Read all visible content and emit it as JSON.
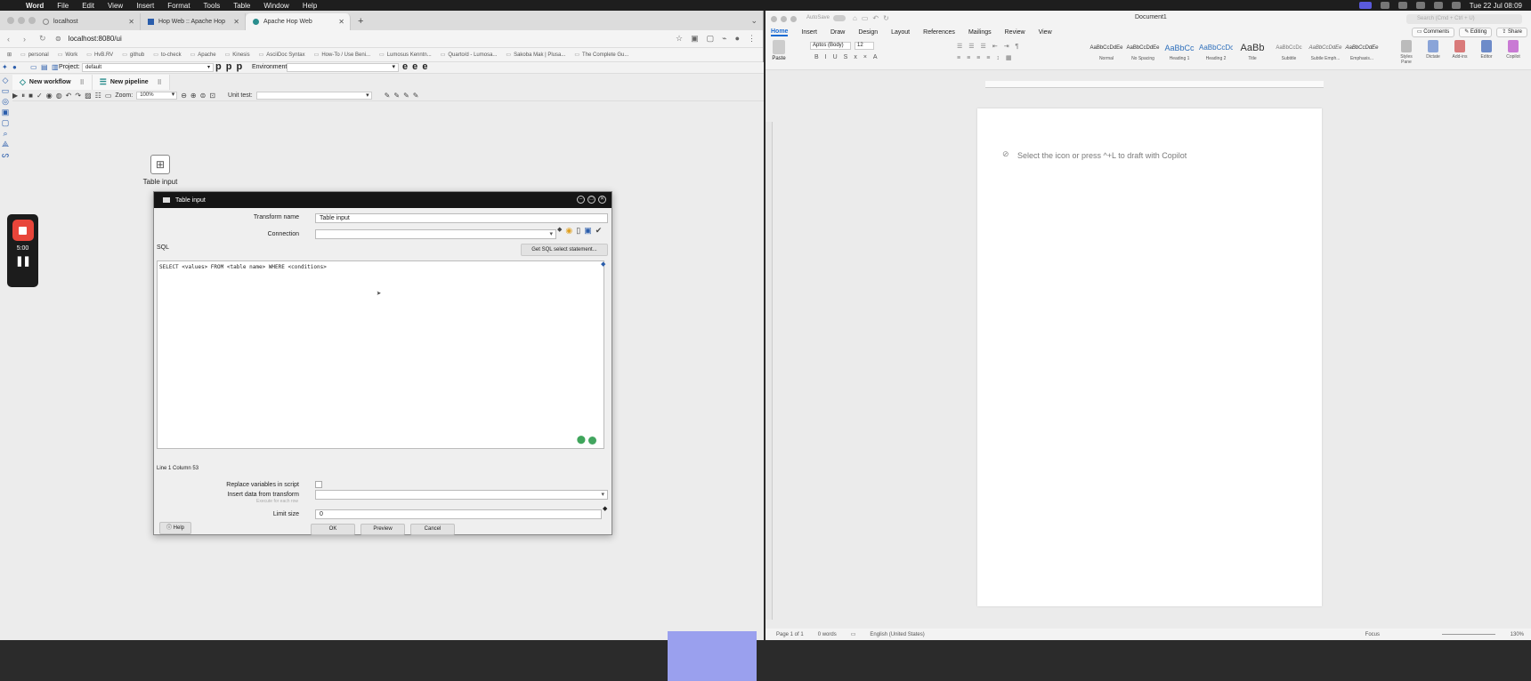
{
  "mac": {
    "app": "Word",
    "menus": [
      "File",
      "Edit",
      "View",
      "Insert",
      "Format",
      "Tools",
      "Table",
      "Window",
      "Help"
    ],
    "clock": "Tue 22 Jul 08:09"
  },
  "browser": {
    "tabs": [
      {
        "label": "localhost"
      },
      {
        "label": "Hop Web :: Apache Hop"
      },
      {
        "label": "Apache Hop Web",
        "active": true
      }
    ],
    "url": "localhost:8080/ui",
    "bookmarks": [
      "personal",
      "Work",
      "HvB.RV",
      "github",
      "to-check",
      "Apache",
      "Kinesis",
      "AsciiDoc Syntax",
      "How-To / Use Beni...",
      "Lumosus Kenntn...",
      "Quarto/d - Lumosa...",
      "Sakoba Mak | Plusa...",
      "The Complete Gu..."
    ]
  },
  "hop": {
    "project_label": "Project:",
    "project_value": "default",
    "env_label": "Environment:",
    "pbtns": "p p p",
    "ebtns": "e e e",
    "tabs": [
      {
        "label": "New workflow"
      },
      {
        "label": "New pipeline"
      }
    ],
    "zoom_label": "Zoom:",
    "zoom_value": "100%",
    "unittest_label": "Unit test:",
    "node_label": "Table input",
    "recorder_time": "5:00"
  },
  "dialog": {
    "title": "Table input",
    "transform_name_label": "Transform name",
    "transform_name_value": "Table input",
    "connection_label": "Connection",
    "sql_label": "SQL",
    "get_sql_button": "Get SQL select statement...",
    "sql_text": "SELECT <values> FROM <table name> WHERE <conditions>",
    "position_text": "Line 1 Column 53",
    "replace_vars_label": "Replace variables in script",
    "insert_data_label": "Insert data from transform",
    "execute_each_row": "Execute for each row",
    "limit_label": "Limit size",
    "limit_value": "0",
    "help_button": "Help",
    "ok_button": "OK",
    "preview_button": "Preview",
    "cancel_button": "Cancel"
  },
  "word": {
    "autosave": "AutoSave",
    "doc_title": "Document1",
    "search_placeholder": "Search (Cmd + Ctrl + U)",
    "tabs": [
      "Home",
      "Insert",
      "Draw",
      "Design",
      "Layout",
      "References",
      "Mailings",
      "Review",
      "View"
    ],
    "comments_btn": "Comments",
    "editing_btn": "Editing",
    "share_btn": "Share",
    "paste": "Paste",
    "font_name": "Aptos (Body)",
    "font_size": "12",
    "styles": [
      {
        "preview": "AaBbCcDdEe",
        "name": "Normal"
      },
      {
        "preview": "AaBbCcDdEe",
        "name": "No Spacing"
      },
      {
        "preview": "AaBbCc",
        "name": "Heading 1"
      },
      {
        "preview": "AaBbCcDc",
        "name": "Heading 2"
      },
      {
        "preview": "AaBb",
        "name": "Title"
      },
      {
        "preview": "AaBbCcDc",
        "name": "Subtitle"
      },
      {
        "preview": "AaBbCcDdEe",
        "name": "Subtle Emph..."
      },
      {
        "preview": "AaBbCcDdEe",
        "name": "Emphasis..."
      }
    ],
    "ribbon_right": [
      "Styles Pane",
      "Dictate",
      "Add-ins",
      "Editor",
      "Copilot"
    ],
    "copilot_hint": "Select the icon or press ^+L to draft with Copilot",
    "status": {
      "page": "Page 1 of 1",
      "words": "0 words",
      "language": "English (United States)",
      "focus": "Focus",
      "zoom": "130%"
    }
  }
}
